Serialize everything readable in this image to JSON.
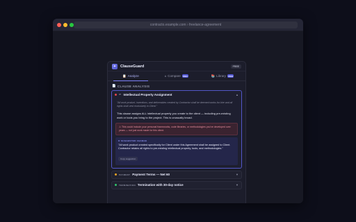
{
  "browser": {
    "url": "contracto.example.com › freelance-agreement"
  },
  "extension": {
    "logo_glyph": "✦",
    "name": "ClauseGuard",
    "plan_badge": "FREE",
    "tabs": [
      {
        "icon": "📋",
        "label": "Analyze",
        "active": true,
        "pro": false
      },
      {
        "icon": "±",
        "label": "Compare",
        "active": false,
        "pro": true
      },
      {
        "icon": "📚",
        "label": "Library",
        "active": false,
        "pro": true
      }
    ],
    "pro_label": "PRO",
    "section_icon": "📄",
    "section_title": "CLAUSE ANALYSIS",
    "clauses": [
      {
        "severity_color": "#e5484d",
        "tag": "IP",
        "name": "Intellectual Property Assignment",
        "expanded": true,
        "chevron": "▲",
        "quote": "\"All work product, inventions, and deliverables created by Contractor shall be deemed works-for-hire and all rights shall vest exclusively in Client.\"",
        "explanation": "This clause assigns ALL intellectual property you create to the client — including pre-existing work or tools you bring to the project. This is unusually broad.",
        "warning": "⚠ This could include your personal frameworks, code libraries, or methodologies you've developed over years — not just work made for this client.",
        "suggestion_label": "✏ SUGGESTED CHANGE",
        "suggestion": "\"All work product created specifically for Client under this Agreement shall be assigned to Client. Contractor retains all rights to pre-existing intellectual property, tools, and methodologies.\"",
        "copy_label": "Copy suggestion"
      },
      {
        "severity_color": "#f5a524",
        "tag": "PAYMENT",
        "name": "Payment Terms — Net 60",
        "expanded": false,
        "chevron": "▼"
      },
      {
        "severity_color": "#30c46b",
        "tag": "TERMINATION",
        "name": "Termination with 30-day notice",
        "expanded": false,
        "chevron": "▼"
      }
    ]
  },
  "colors": {
    "accent": "#7d81f7",
    "page_bg": "#0d0e1a",
    "panel_bg": "#1c1d2b"
  }
}
